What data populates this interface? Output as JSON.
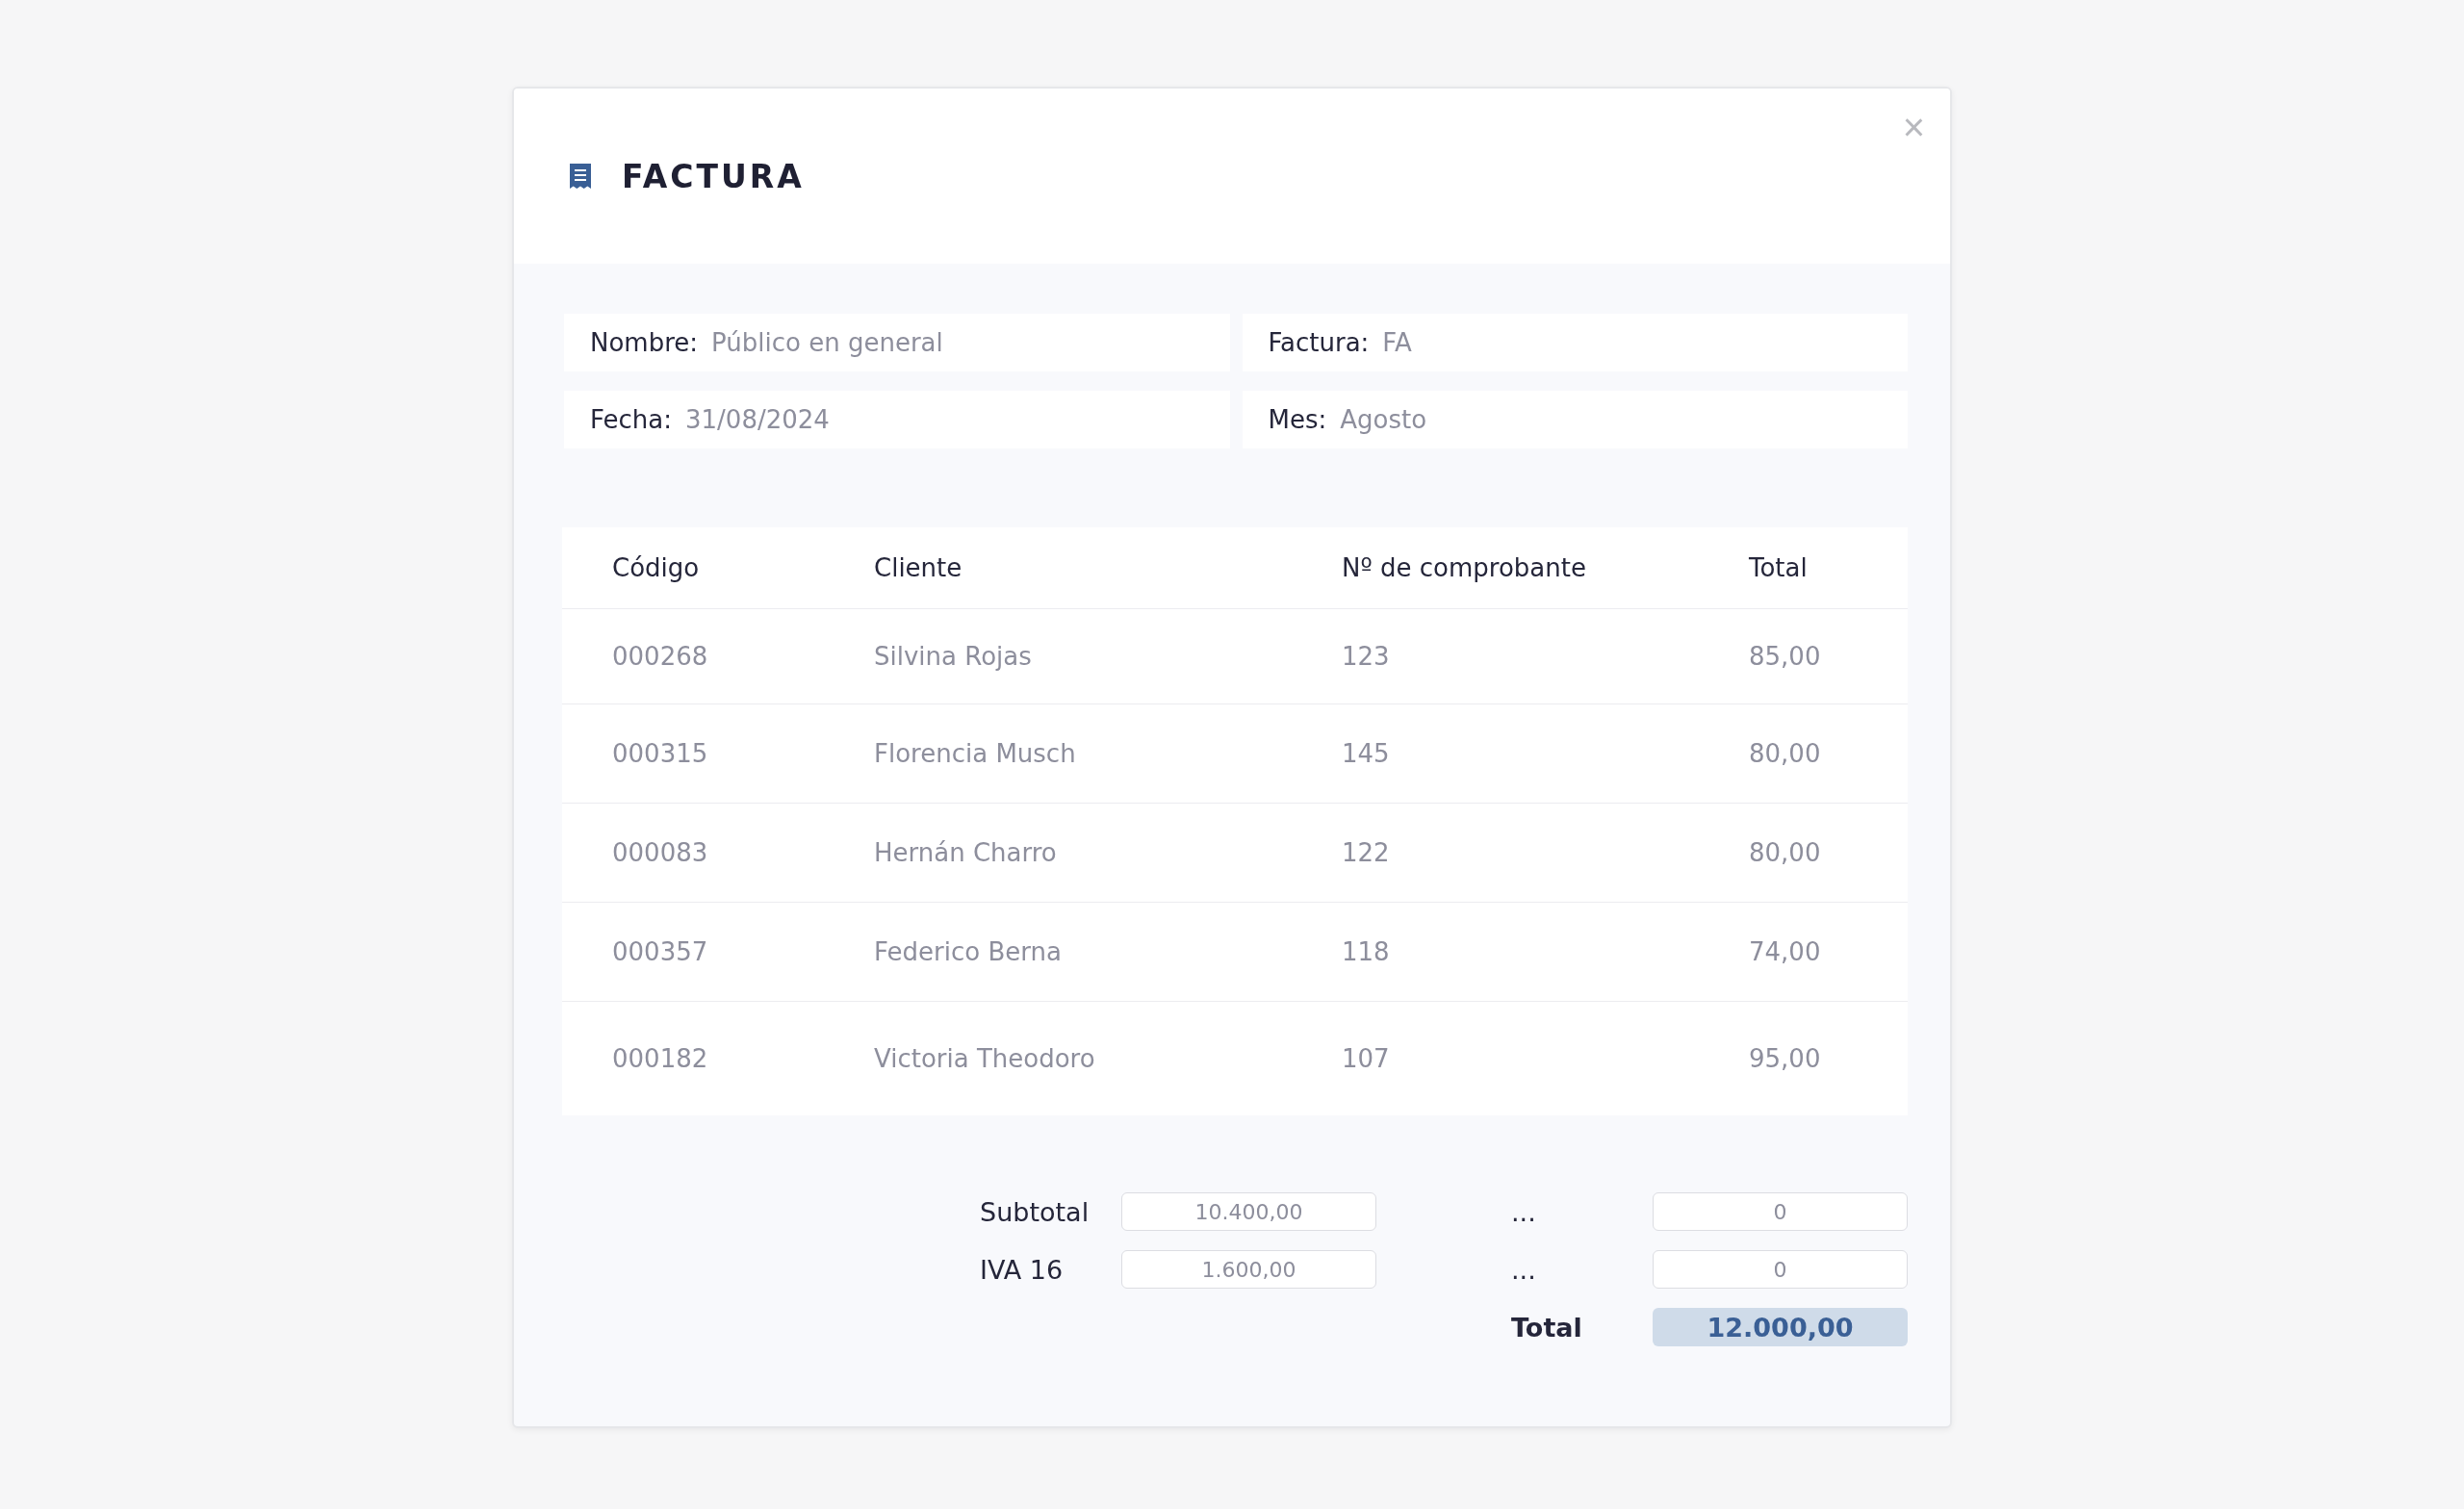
{
  "dialog": {
    "title": "FACTURA",
    "close": "×"
  },
  "fields": [
    {
      "label": "Nombre:",
      "value": "Público en general"
    },
    {
      "label": "Factura:",
      "value": "FA"
    },
    {
      "label": "Fecha:",
      "value": "31/08/2024"
    },
    {
      "label": "Mes:",
      "value": "Agosto"
    }
  ],
  "table": {
    "columns": [
      "Código",
      "Cliente",
      "Nº de comprobante",
      "Total"
    ],
    "rows": [
      [
        "000268",
        "Silvina Rojas",
        "123",
        "85,00"
      ],
      [
        "000315",
        "Florencia Musch",
        "145",
        "80,00"
      ],
      [
        "000083",
        "Hernán Charro",
        "122",
        "80,00"
      ],
      [
        "000357",
        "Federico Berna",
        "118",
        "74,00"
      ],
      [
        "000182",
        "Victoria Theodoro",
        "107",
        "95,00"
      ]
    ]
  },
  "totals": {
    "left": [
      {
        "label": "Subtotal",
        "value": "10.400,00",
        "kind": "field"
      },
      {
        "label": "IVA 16",
        "value": "1.600,00",
        "kind": "field"
      }
    ],
    "right": [
      {
        "label": "...",
        "value": "0",
        "kind": "field"
      },
      {
        "label": "...",
        "value": "0",
        "kind": "field"
      },
      {
        "label": "Total",
        "value": "12.000,00",
        "kind": "total"
      }
    ]
  }
}
